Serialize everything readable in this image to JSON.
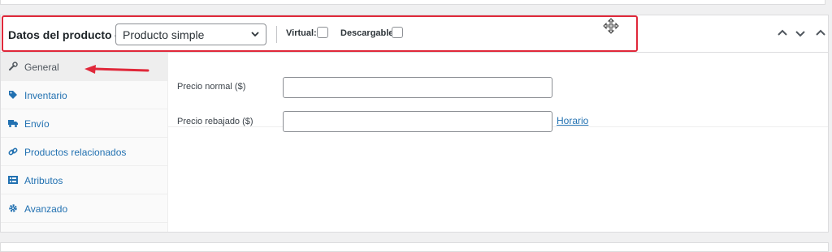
{
  "header": {
    "title": "Datos del producto —",
    "product_type": "Producto simple",
    "virtual_label": "Virtual:",
    "downloadable_label": "Descargable:"
  },
  "tabs": [
    {
      "label": "General",
      "icon": "wrench-icon",
      "active": true
    },
    {
      "label": "Inventario",
      "icon": "tag-icon",
      "active": false
    },
    {
      "label": "Envío",
      "icon": "truck-icon",
      "active": false
    },
    {
      "label": "Productos relacionados",
      "icon": "link-icon",
      "active": false
    },
    {
      "label": "Atributos",
      "icon": "list-icon",
      "active": false
    },
    {
      "label": "Avanzado",
      "icon": "gear-icon",
      "active": false
    }
  ],
  "general": {
    "regular_price_label": "Precio normal ($)",
    "regular_price_value": "",
    "sale_price_label": "Precio rebajado ($)",
    "sale_price_value": "",
    "schedule_link": "Horario"
  },
  "colors": {
    "annotation": "#e0283a",
    "link": "#2271b1"
  }
}
